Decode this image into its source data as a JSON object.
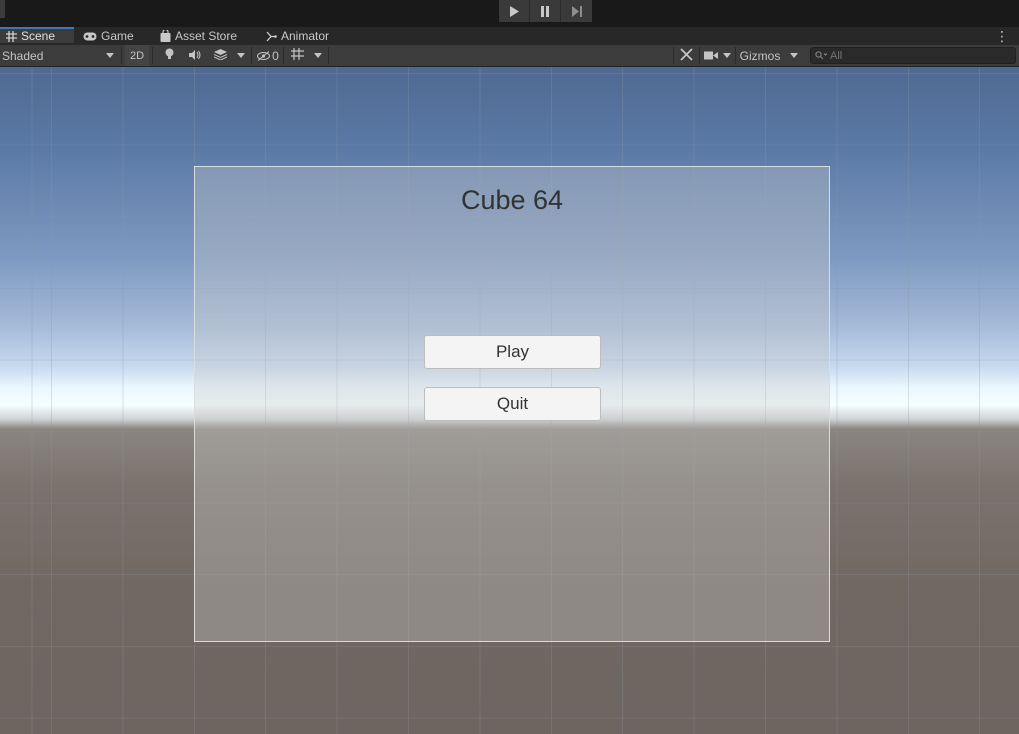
{
  "playbar": {
    "buttons": [
      {
        "name": "play-icon"
      },
      {
        "name": "pause-icon"
      },
      {
        "name": "step-icon"
      }
    ]
  },
  "tabs": [
    {
      "label": "Scene",
      "icon": "hash-icon",
      "active": true
    },
    {
      "label": "Game",
      "icon": "gamepad-icon",
      "active": false
    },
    {
      "label": "Asset Store",
      "icon": "shopping-bag-icon",
      "active": false
    },
    {
      "label": "Animator",
      "icon": "animator-icon",
      "active": false
    }
  ],
  "toolbar": {
    "draw_mode": "Shaded",
    "toggle_2d": "2D",
    "hidden_count": "0",
    "gizmos": "Gizmos",
    "search_placeholder": "All"
  },
  "scene": {
    "title": "Cube 64",
    "play_label": "Play",
    "quit_label": "Quit"
  },
  "colors": {
    "accent": "#3a79bb",
    "toolbar_bg": "#3c3c3c",
    "button_bg": "#f4f4f4"
  }
}
